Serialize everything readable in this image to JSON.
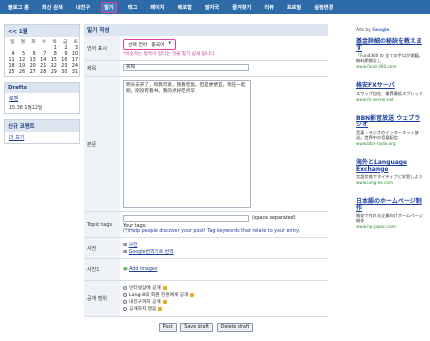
{
  "nav": {
    "items": [
      "블로그 홈",
      "최신 검색",
      "내친구",
      "알기",
      "태그",
      "페이지",
      "배포함",
      "발자국",
      "즐겨찾기",
      "리뷰",
      "프로필",
      "설정변경"
    ],
    "home_icon": "home-icon"
  },
  "left": {
    "calendar": {
      "title": "<< 1월",
      "weekdays": [
        "일",
        "월",
        "화",
        "수",
        "목",
        "금",
        "토"
      ],
      "weeks": [
        [
          "",
          "",
          "",
          "",
          "1",
          "2",
          "3"
        ],
        [
          "4",
          "5",
          "6",
          "7",
          "8",
          "9",
          "10"
        ],
        [
          "11",
          "12",
          "13",
          "14",
          "15",
          "16",
          "17"
        ],
        [
          "18",
          "19",
          "20",
          "21",
          "22",
          "23",
          "24"
        ],
        [
          "25",
          "26",
          "27",
          "28",
          "29",
          "30",
          "31"
        ]
      ]
    },
    "drafts": {
      "title": "Drafts",
      "link": "로맨",
      "time": "15:38 1월12일"
    },
    "comments": {
      "title": "신규 코멘트",
      "link": "더 보기"
    }
  },
  "main": {
    "header": "일기 작성",
    "lang_label": "언어 표시",
    "lang_opt1": "선택 언어",
    "lang_opt2": "중국어",
    "lang_note": "*비슷하는 항목이 있다는 것을 찾기 쉽게 됩니다",
    "title_label": "제목",
    "title_value": "买和",
    "body_label": "본문",
    "body_value": "明天去买了，和我可爱，我看吃饭。但是便便宜。现在一起刚，刚没有看书。我的点好吃点华",
    "tags_label": "Topic tags",
    "tags_hint": "(space separated)",
    "your_tags": "Your tags:",
    "tag_help": "(*)Help people discover your post! Tag keywords that relate to your entry.",
    "dict_label": "사전",
    "dict1": "사전",
    "dict2": "Google번역기로 번역",
    "photo_label": "사진1",
    "add_images": "Add images",
    "privacy_label": "공개 범위",
    "opt1": "인터넷상에 공개",
    "opt2": "Lang-8의 회원 전원에게 공개",
    "opt3": "내친구까지 공개",
    "opt4": "공개하지 않음",
    "btn_post": "Post",
    "btn_save": "Save draft",
    "btn_delete": "Delete draft"
  },
  "ads": {
    "by": "Ads by",
    "google": "Google",
    "items": [
      {
        "title": "基金詳細の秘訣を教えます",
        "desc": "「Fund360 の 全ての手口が満載。無料期間なし",
        "url": "www.fund-360.com"
      },
      {
        "title": "格安FXサーバ",
        "desc": "スワップ自在、業界最低スプレッド",
        "url": "www.fx-server.net"
      },
      {
        "title": "BBN影音放送 ウェブラジオ",
        "desc": "音楽・ラジオのインターネット放送。世界中の音楽配信",
        "url": "www.bbn-radio.org"
      },
      {
        "title": "海外とLanguage Exchange",
        "desc": "言語交換でネイティブと学習しよう",
        "url": "www.lang-ex.com"
      },
      {
        "title": "日本語のホームページ制作",
        "desc": "格安で作れる企業向けホームページ制作",
        "url": "www.hp-japan.com"
      }
    ]
  }
}
